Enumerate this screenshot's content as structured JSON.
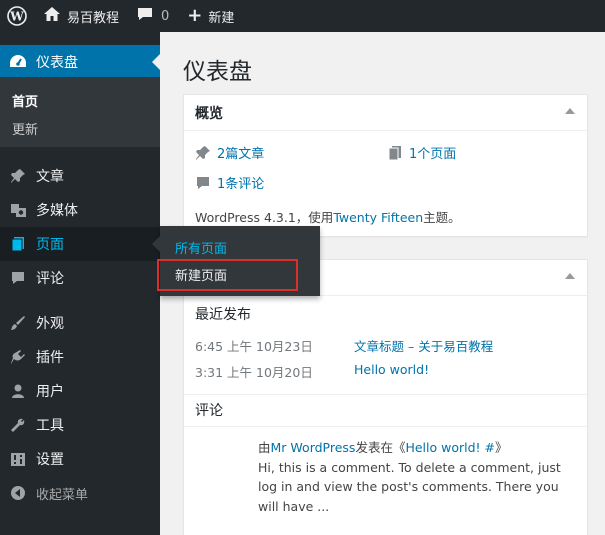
{
  "adminbar": {
    "site_name": "易百教程",
    "comments_count": "0",
    "new_label": "新建"
  },
  "sidebar": {
    "dashboard": "仪表盘",
    "sub_home": "首页",
    "sub_updates": "更新",
    "items": [
      {
        "label": "文章",
        "icon": "pin-icon"
      },
      {
        "label": "多媒体",
        "icon": "media-icon"
      },
      {
        "label": "页面",
        "icon": "pages-icon"
      },
      {
        "label": "评论",
        "icon": "comment-icon"
      },
      {
        "label": "外观",
        "icon": "brush-icon"
      },
      {
        "label": "插件",
        "icon": "plugin-icon"
      },
      {
        "label": "用户",
        "icon": "user-icon"
      },
      {
        "label": "工具",
        "icon": "wrench-icon"
      },
      {
        "label": "设置",
        "icon": "settings-icon"
      }
    ],
    "collapse": "收起菜单"
  },
  "flyout": {
    "all_pages": "所有页面",
    "new_page": "新建页面"
  },
  "main": {
    "title": "仪表盘",
    "glance": {
      "title": "概览",
      "posts": "2篇文章",
      "pages": "1个页面",
      "comments": "1条评论",
      "version_prefix": "WordPress 4.3.1，使用",
      "theme": "Twenty Fifteen",
      "version_suffix": "主题。"
    },
    "activity": {
      "recent_label": "最近发布",
      "rows": [
        {
          "date": "6:45 上午 10月23日",
          "title": "文章标题 – 关于易百教程"
        },
        {
          "date": "3:31 上午 10月20日",
          "title": "Hello world!"
        }
      ],
      "comments_label": "评论",
      "comment_from": "由",
      "comment_author": "Mr WordPress",
      "comment_on": "发表在《",
      "comment_post": "Hello world! #",
      "comment_close": "》",
      "comment_body": "Hi, this is a comment. To delete a comment, just log in and view the post's comments. There you will have ..."
    }
  },
  "colors": {
    "admin_bg": "#23282d",
    "accent": "#0073aa",
    "highlight_border": "#d9302a"
  }
}
